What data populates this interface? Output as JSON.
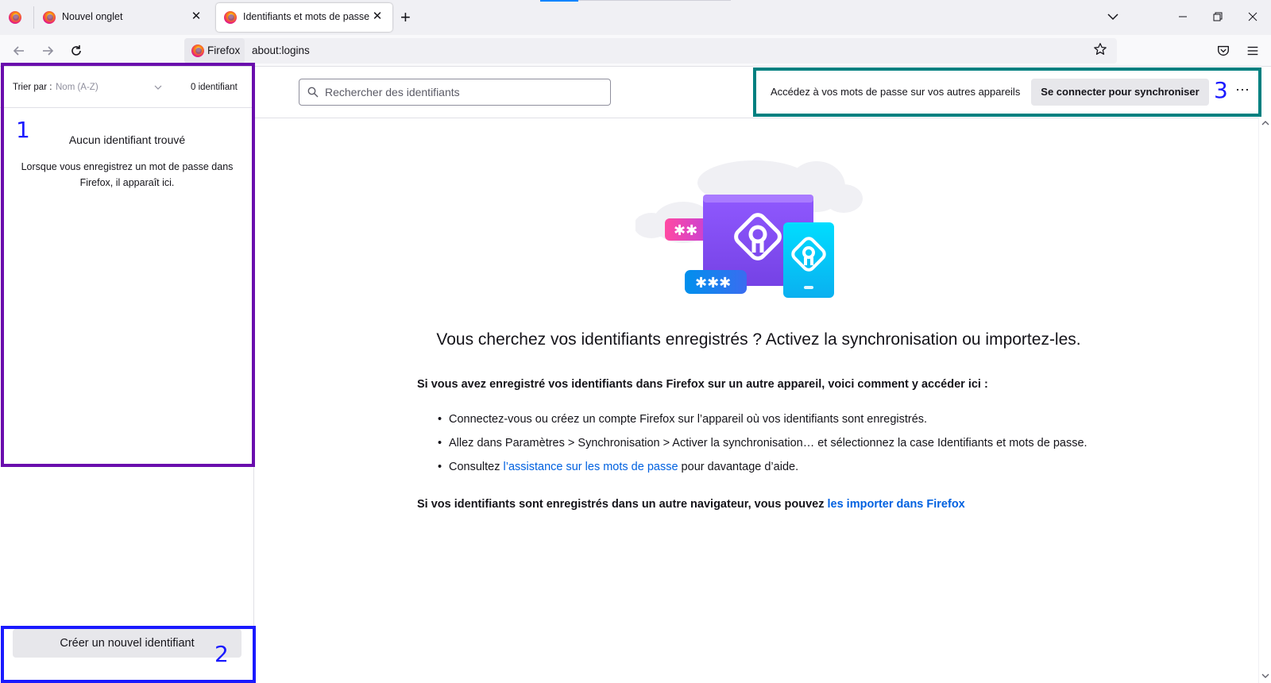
{
  "browser": {
    "tabs": [
      {
        "title": "Nouvel onglet",
        "active": false
      },
      {
        "title": "Identifiants et mots de passe",
        "active": true
      }
    ],
    "close_glyph": "✕",
    "new_tab_glyph": "+",
    "identity_label": "Firefox",
    "url": "about:logins"
  },
  "sidebar": {
    "sort_label": "Trier par :",
    "sort_value": "Nom (A-Z)",
    "count": "0 identifiant",
    "empty_title": "Aucun identifiant trouvé",
    "empty_desc": "Lorsque vous enregistrez un mot de passe dans Firefox, il apparaît ici.",
    "create_button": "Créer un nouvel identifiant"
  },
  "header": {
    "search_placeholder": "Rechercher des identifiants",
    "sync_text": "Accédez à vos mots de passe sur vos autres appareils",
    "sync_button": "Se connecter pour synchroniser",
    "more_glyph": "⋯"
  },
  "main": {
    "heading": "Vous cherchez vos identifiants enregistrés ? Activez la synchronisation ou importez-les.",
    "intro": "Si vous avez enregistré vos identifiants dans Firefox sur un autre appareil, voici comment y accéder ici :",
    "step1": "Connectez-vous ou créez un compte Firefox sur l’appareil où vos identifiants sont enregistrés.",
    "step2": "Allez dans Paramètres > Synchronisation > Activer la synchronisation… et sélectionnez la case Identifiants et mots de passe.",
    "step3_pre": "Consultez ",
    "step3_link": "l’assistance sur les mots de passe",
    "step3_post": " pour davantage d’aide.",
    "import_pre": "Si vos identifiants sont enregistrés dans un autre navigateur, vous pouvez ",
    "import_link": "les importer dans Firefox",
    "illus_stars_small": "✱✱",
    "illus_stars_big": "✱✱✱"
  },
  "annotations": [
    {
      "number": "1",
      "color": "#6a0dad"
    },
    {
      "number": "2",
      "color": "#1a1aff"
    },
    {
      "number": "3",
      "color": "#008080"
    }
  ],
  "colors": {
    "accent": "#0061e0",
    "annotation_purple": "#6a0dad",
    "annotation_blue": "#1a1aff",
    "annotation_teal": "#008080"
  }
}
